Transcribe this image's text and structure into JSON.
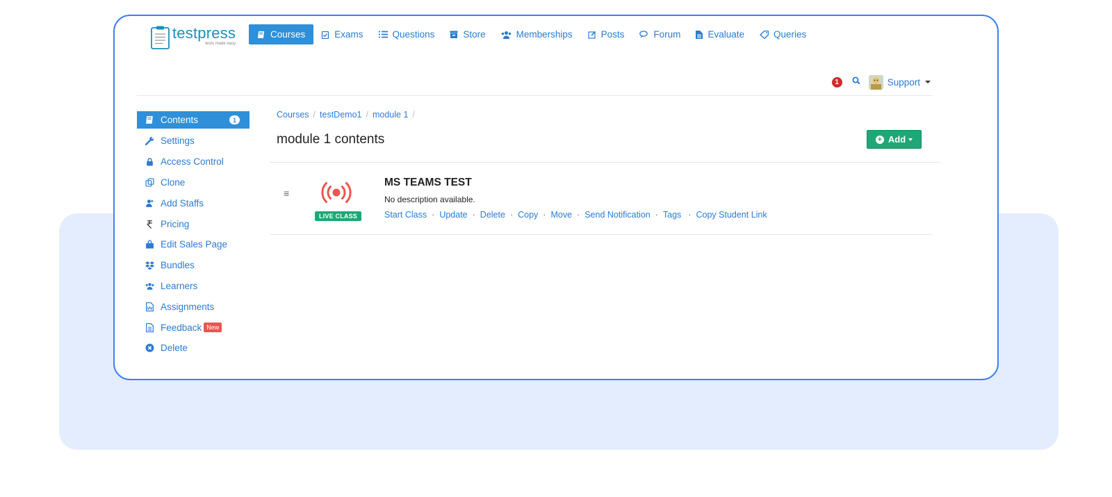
{
  "logo": {
    "word": "testpress",
    "tagline": "tests made easy"
  },
  "nav": [
    {
      "label": "Courses",
      "icon": "book-icon",
      "active": true
    },
    {
      "label": "Exams",
      "icon": "clipboard-check-icon"
    },
    {
      "label": "Questions",
      "icon": "list-icon"
    },
    {
      "label": "Store",
      "icon": "store-icon"
    },
    {
      "label": "Memberships",
      "icon": "users-icon"
    },
    {
      "label": "Posts",
      "icon": "edit-icon"
    },
    {
      "label": "Forum",
      "icon": "chat-icon"
    },
    {
      "label": "Evaluate",
      "icon": "file-icon"
    },
    {
      "label": "Queries",
      "icon": "tag-icon"
    }
  ],
  "user": {
    "notification_count": "1",
    "name": "Support"
  },
  "sidebar": {
    "items": [
      {
        "label": "Contents",
        "icon": "book-icon",
        "badge": "1",
        "active": true
      },
      {
        "label": "Settings",
        "icon": "wrench-icon"
      },
      {
        "label": "Access Control",
        "icon": "lock-icon"
      },
      {
        "label": "Clone",
        "icon": "clone-icon"
      },
      {
        "label": "Add Staffs",
        "icon": "user-plus-icon"
      },
      {
        "label": "Pricing",
        "icon": "rupee-icon"
      },
      {
        "label": "Edit Sales Page",
        "icon": "shopping-bag-icon"
      },
      {
        "label": "Bundles",
        "icon": "dropbox-icon"
      },
      {
        "label": "Learners",
        "icon": "users-icon"
      },
      {
        "label": "Assignments",
        "icon": "file-word-icon"
      },
      {
        "label": "Feedback",
        "icon": "file-text-icon",
        "new_badge": "New"
      },
      {
        "label": "Delete",
        "icon": "times-circle-icon"
      }
    ]
  },
  "breadcrumb": [
    "Courses",
    "testDemo1",
    "module 1"
  ],
  "page_title": "module 1 contents",
  "add_button": "Add",
  "content_item": {
    "badge": "LIVE CLASS",
    "title": "MS TEAMS TEST",
    "description": "No description available.",
    "actions": [
      "Start Class",
      "Update",
      "Delete",
      "Copy",
      "Move",
      "Send Notification",
      "Tags",
      "Copy Student Link"
    ]
  },
  "colors": {
    "accent": "#2f8fd8",
    "success": "#1fa777",
    "danger": "#e9574f",
    "frame_border": "#3d7ff0",
    "panel_bg": "#e4edfd"
  }
}
